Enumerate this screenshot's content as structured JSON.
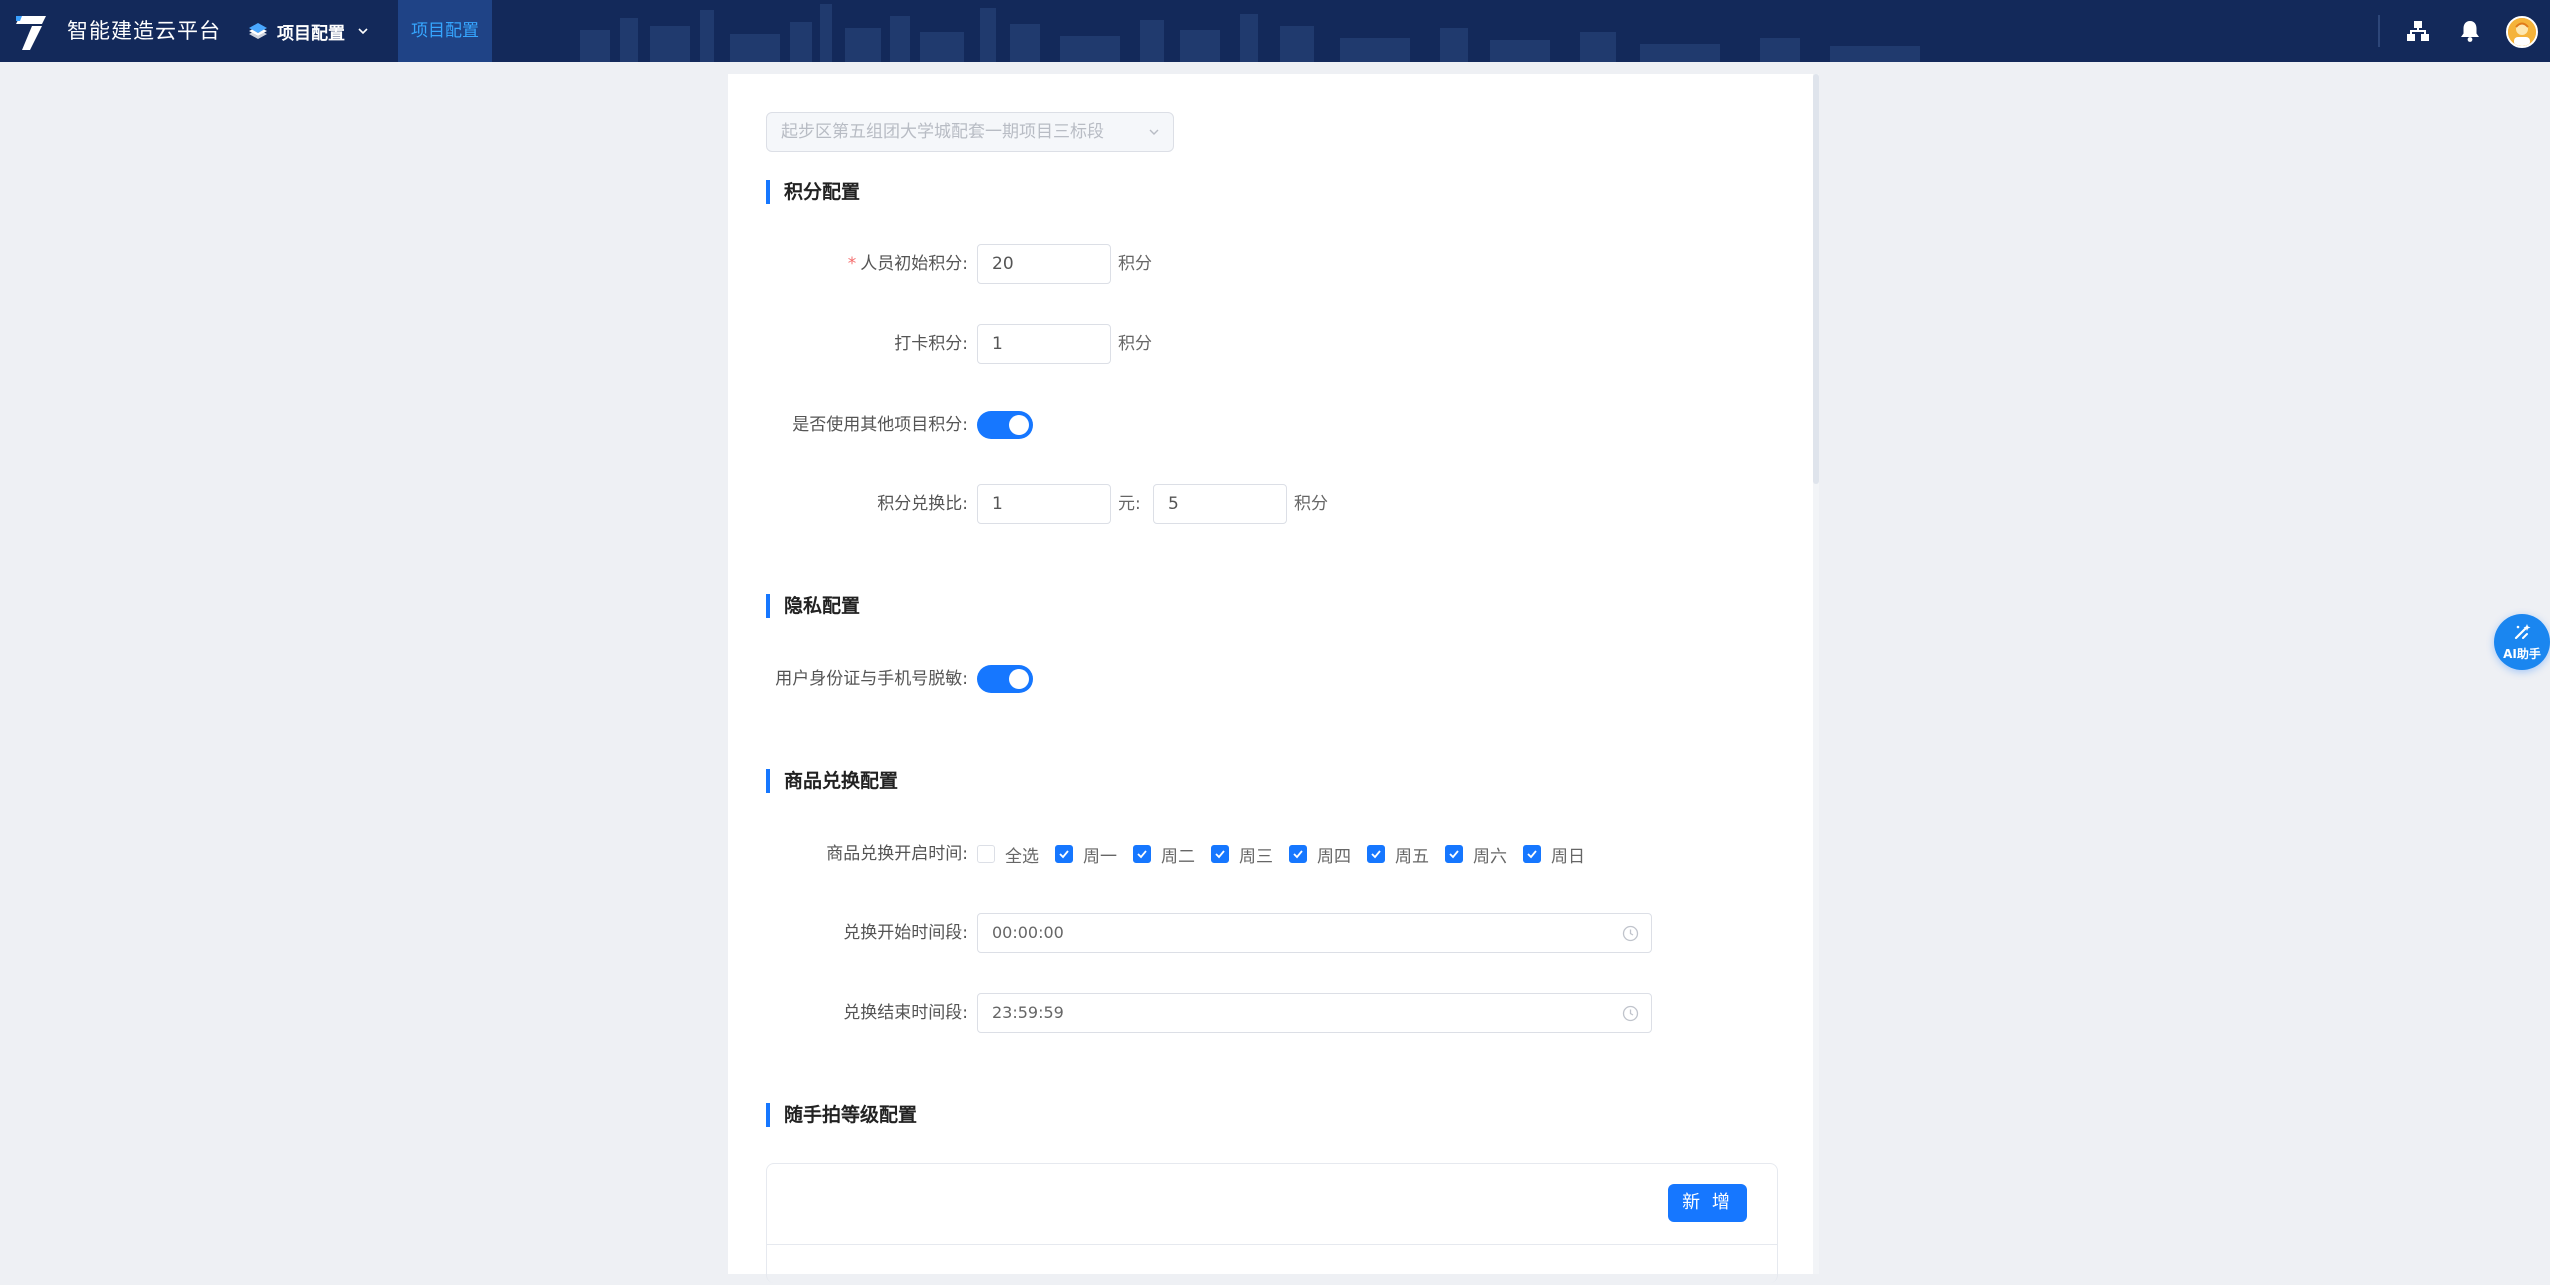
{
  "header": {
    "app_name": "智能建造云平台",
    "project_menu_label": "项目配置",
    "active_tab_label": "项目配置",
    "icons": [
      "org-chart-icon",
      "bell-icon",
      "avatar"
    ]
  },
  "project_select": {
    "value": "起步区第五组团大学城配套一期项目三标段"
  },
  "points_section": {
    "title": "积分配置",
    "initial_points_label": "人员初始积分:",
    "initial_points_value": "20",
    "initial_points_unit": "积分",
    "checkin_points_label": "打卡积分:",
    "checkin_points_value": "1",
    "checkin_points_unit": "积分",
    "use_other_label": "是否使用其他项目积分:",
    "use_other_on": true,
    "ratio_label": "积分兑换比:",
    "ratio_yuan_value": "1",
    "ratio_yuan_unit": "元:",
    "ratio_points_value": "5",
    "ratio_points_unit": "积分"
  },
  "privacy_section": {
    "title": "隐私配置",
    "desensitize_label": "用户身份证与手机号脱敏:",
    "desensitize_on": true
  },
  "exchange_section": {
    "title": "商品兑换配置",
    "open_time_label": "商品兑换开启时间:",
    "select_all_label": "全选",
    "select_all_checked": false,
    "days": [
      {
        "label": "周一",
        "checked": true
      },
      {
        "label": "周二",
        "checked": true
      },
      {
        "label": "周三",
        "checked": true
      },
      {
        "label": "周四",
        "checked": true
      },
      {
        "label": "周五",
        "checked": true
      },
      {
        "label": "周六",
        "checked": true
      },
      {
        "label": "周日",
        "checked": true
      }
    ],
    "start_time_label": "兑换开始时间段:",
    "start_time_value": "00:00:00",
    "end_time_label": "兑换结束时间段:",
    "end_time_value": "23:59:59"
  },
  "photo_level_section": {
    "title": "随手拍等级配置",
    "add_button_label": "新 增"
  },
  "ai_helper": {
    "label": "AI助手"
  },
  "colors": {
    "header_bg": "#13295a",
    "active_tab_bg": "#1f4386",
    "active_tab_text": "#36a6ff",
    "accent": "#1677ff",
    "required_star": "#f56c6c"
  }
}
